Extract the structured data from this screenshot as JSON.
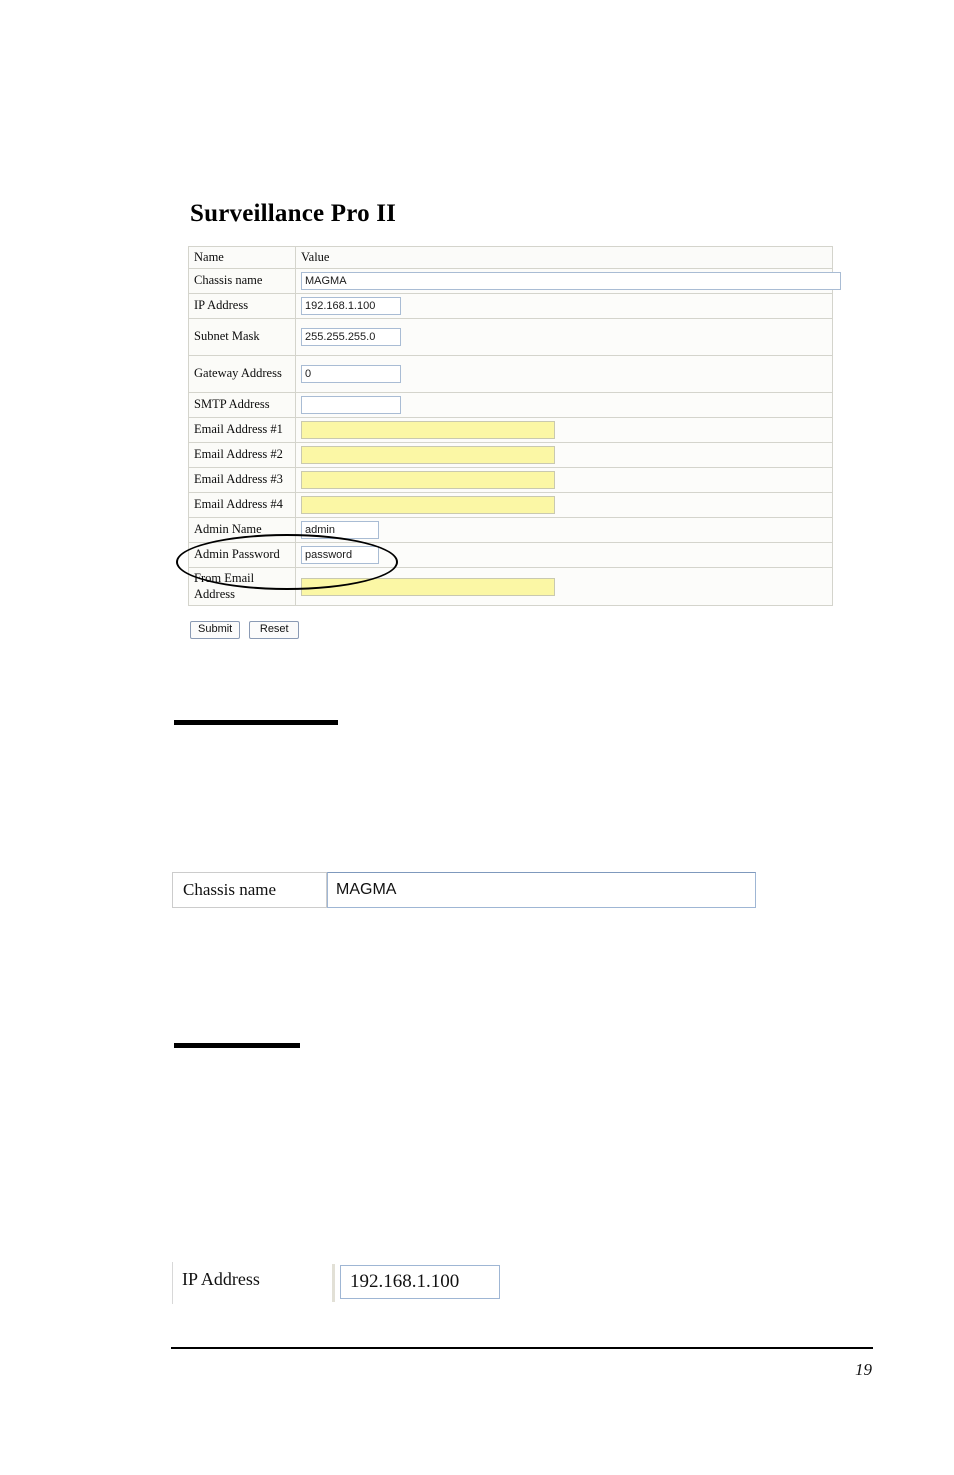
{
  "document": {
    "page_number": "19"
  },
  "web_form": {
    "app_title": "Surveillance Pro II",
    "columns": {
      "name": "Name",
      "value": "Value"
    },
    "rows": [
      {
        "label": "Chassis name",
        "value": "MAGMA",
        "field": "wide",
        "highlighted": false
      },
      {
        "label": "IP Address",
        "value": "192.168.1.100",
        "field": "medium",
        "highlighted": false
      },
      {
        "label": "Subnet Mask",
        "value": "255.255.255.0",
        "field": "medium",
        "highlighted": false
      },
      {
        "label": "Gateway Address",
        "value": "0",
        "field": "medium",
        "highlighted": false
      },
      {
        "label": "SMTP Address",
        "value": "",
        "field": "medium",
        "highlighted": false
      },
      {
        "label": "Email Address #1",
        "value": "",
        "field": "yellow",
        "highlighted": false
      },
      {
        "label": "Email Address #2",
        "value": "",
        "field": "yellow",
        "highlighted": false
      },
      {
        "label": "Email Address #3",
        "value": "",
        "field": "yellow",
        "highlighted": false
      },
      {
        "label": "Email Address #4",
        "value": "",
        "field": "yellow",
        "highlighted": false
      },
      {
        "label": "Admin Name",
        "value": "admin",
        "field": "admin",
        "highlighted": true
      },
      {
        "label": "Admin Password",
        "value": "password",
        "field": "admin",
        "highlighted": true
      },
      {
        "label": "From Email Address",
        "value": "",
        "field": "yellow",
        "highlighted": false
      }
    ],
    "buttons": {
      "submit": "Submit",
      "reset": "Reset"
    },
    "colors": {
      "highlight_field": "#FBF7A5",
      "input_border": "#A9BCD4",
      "table_border": "#D4D4CC",
      "annotation": "#000000"
    }
  },
  "detail_chassis": {
    "label": "Chassis name",
    "value": "MAGMA"
  },
  "detail_ip": {
    "label": "IP Address",
    "value": "192.168.1.100"
  }
}
